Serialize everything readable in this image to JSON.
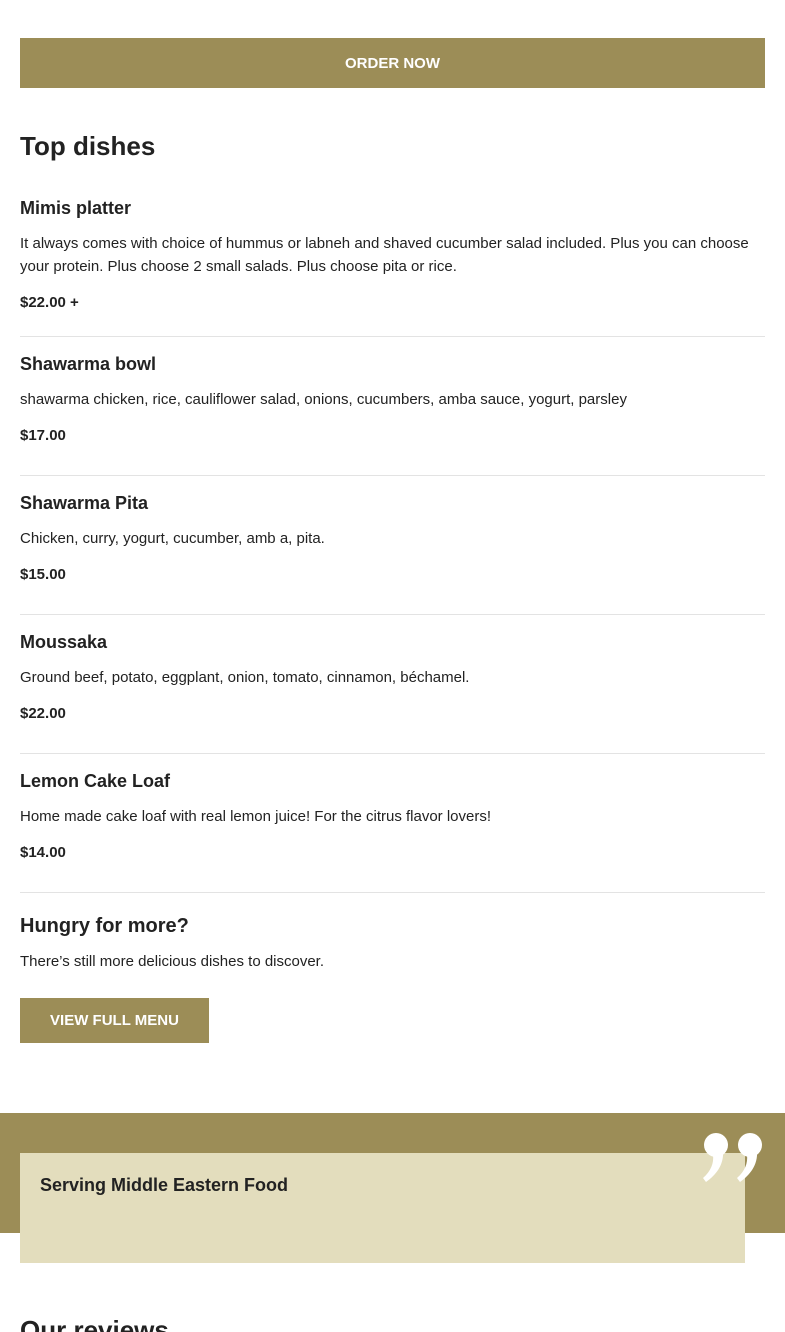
{
  "order_button": "ORDER NOW",
  "top_dishes": {
    "title": "Top dishes",
    "items": [
      {
        "name": "Mimis platter",
        "description": "It always comes with choice of hummus or labneh and shaved cucumber salad included. Plus you can choose your protein. Plus choose 2 small salads. Plus choose pita or rice.",
        "price": "$22.00 +"
      },
      {
        "name": "Shawarma bowl",
        "description": "shawarma chicken, rice, cauliflower salad, onions, cucumbers, amba sauce, yogurt, parsley",
        "price": "$17.00"
      },
      {
        "name": "Shawarma Pita",
        "description": "Chicken, curry, yogurt, cucumber, amb a, pita.",
        "price": "$15.00"
      },
      {
        "name": "Moussaka",
        "description": "Ground beef, potato, eggplant, onion, tomato, cinnamon, béchamel.",
        "price": "$22.00"
      },
      {
        "name": "Lemon Cake Loaf",
        "description": "Home made cake loaf with real lemon juice! For the citrus flavor lovers!",
        "price": "$14.00"
      }
    ]
  },
  "hungry": {
    "title": "Hungry for more?",
    "text": "There’s still more delicious dishes to discover.",
    "button": "VIEW FULL MENU"
  },
  "quote": {
    "title": "Serving Middle Eastern Food",
    "icon": "quote-icon"
  },
  "reviews": {
    "title": "Our reviews"
  },
  "colors": {
    "accent": "#9c8d57",
    "card": "#e3ddbd"
  }
}
